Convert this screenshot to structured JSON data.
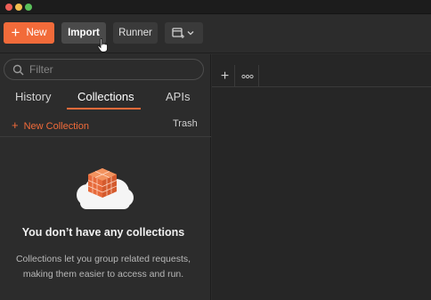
{
  "toolbar": {
    "new_label": "New",
    "import_label": "Import",
    "runner_label": "Runner"
  },
  "sidebar": {
    "search": {
      "placeholder": "Filter",
      "value": ""
    },
    "tabs": [
      {
        "label": "History"
      },
      {
        "label": "Collections",
        "active": true
      },
      {
        "label": "APIs"
      }
    ],
    "new_collection_label": "New Collection",
    "trash_label": "Trash",
    "empty_state": {
      "title": "You don’t have any collections",
      "description_line1": "Collections let you group related requests,",
      "description_line2": "making them easier to access and run."
    }
  },
  "colors": {
    "accent": "#f26b3a",
    "background": "#2c2c2c",
    "workspace_background": "#262626"
  },
  "icons": {
    "search": "search-icon",
    "plus": "plus-icon",
    "view_toggle": "new-window-icon",
    "more": "more-options-icon",
    "cursor": "hand-pointer-cursor",
    "empty_state": "collection-box-illustration"
  }
}
